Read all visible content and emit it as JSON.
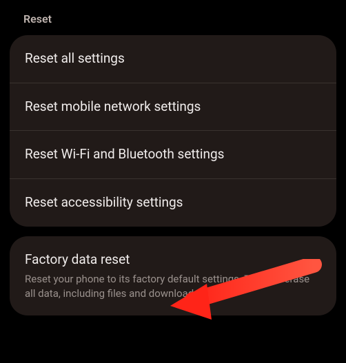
{
  "header": {
    "title": "Reset"
  },
  "group1": {
    "items": [
      {
        "title": "Reset all settings"
      },
      {
        "title": "Reset mobile network settings"
      },
      {
        "title": "Reset Wi-Fi and Bluetooth settings"
      },
      {
        "title": "Reset accessibility settings"
      }
    ]
  },
  "group2": {
    "items": [
      {
        "title": "Factory data reset",
        "desc": "Reset your phone to its factory default settings. This will erase all data, including files and downloaded apps."
      }
    ]
  },
  "annotation": {
    "arrow_color": "#ff3b30"
  }
}
